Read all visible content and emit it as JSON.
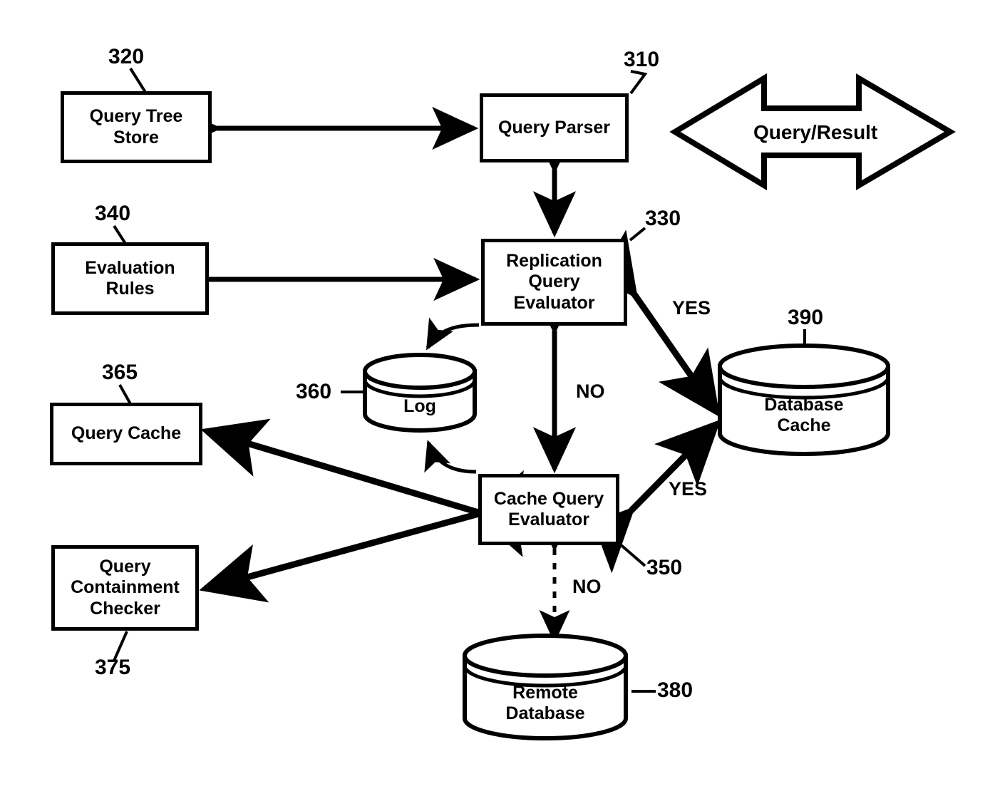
{
  "figure": {
    "type": "patent-block-diagram",
    "background": "#ffffff",
    "stroke_color": "#000000"
  },
  "nodes": {
    "query_tree_store": {
      "label": "Query Tree\nStore",
      "line1": "Query Tree",
      "line2": "Store",
      "ref": "320"
    },
    "query_parser": {
      "label": "Query Parser",
      "line1": "Query Parser",
      "ref": "310"
    },
    "evaluation_rules": {
      "line1": "Evaluation",
      "line2": "Rules",
      "ref": "340"
    },
    "replication_query_evaluator": {
      "line1": "Replication",
      "line2": "Query",
      "line3": "Evaluator",
      "ref": "330"
    },
    "query_cache": {
      "line1": "Query Cache",
      "ref": "365"
    },
    "query_containment_checker": {
      "line1": "Query",
      "line2": "Containment",
      "line3": "Checker",
      "ref": "375"
    },
    "cache_query_evaluator": {
      "line1": "Cache Query",
      "line2": "Evaluator",
      "ref": "350"
    },
    "log": {
      "line1": "Log",
      "ref": "360"
    },
    "database_cache": {
      "line1": "Database",
      "line2": "Cache",
      "ref": "390"
    },
    "remote_database": {
      "line1": "Remote",
      "line2": "Database",
      "ref": "380"
    }
  },
  "annotations": {
    "query_result": "Query/Result",
    "yes_upper": "YES",
    "yes_lower": "YES",
    "no_middle": "NO",
    "no_lower": "NO"
  },
  "chart_data": {
    "type": "diagram",
    "title": "",
    "nodes": [
      {
        "id": "320",
        "name": "Query Tree Store",
        "shape": "rect"
      },
      {
        "id": "310",
        "name": "Query Parser",
        "shape": "rect"
      },
      {
        "id": "340",
        "name": "Evaluation Rules",
        "shape": "rect"
      },
      {
        "id": "330",
        "name": "Replication Query Evaluator",
        "shape": "rect"
      },
      {
        "id": "365",
        "name": "Query Cache",
        "shape": "rect"
      },
      {
        "id": "375",
        "name": "Query Containment Checker",
        "shape": "rect"
      },
      {
        "id": "350",
        "name": "Cache Query Evaluator",
        "shape": "rect"
      },
      {
        "id": "360",
        "name": "Log",
        "shape": "cylinder"
      },
      {
        "id": "390",
        "name": "Database Cache",
        "shape": "cylinder"
      },
      {
        "id": "380",
        "name": "Remote Database",
        "shape": "cylinder"
      }
    ],
    "edges": [
      {
        "from": "310",
        "to": "320",
        "style": "double-arrow",
        "label": ""
      },
      {
        "from": "310",
        "to": "external",
        "style": "double-arrow-block",
        "label": "Query/Result"
      },
      {
        "from": "310",
        "to": "330",
        "style": "double-arrow",
        "label": ""
      },
      {
        "from": "330",
        "to": "340",
        "style": "double-arrow",
        "label": ""
      },
      {
        "from": "330",
        "to": "390",
        "style": "double-arrow",
        "label": "YES"
      },
      {
        "from": "330",
        "to": "350",
        "style": "double-arrow",
        "label": "NO"
      },
      {
        "from": "330",
        "to": "360",
        "style": "curved-arrow",
        "label": ""
      },
      {
        "from": "350",
        "to": "360",
        "style": "curved-arrow",
        "label": ""
      },
      {
        "from": "350",
        "to": "365",
        "style": "double-arrow",
        "label": ""
      },
      {
        "from": "350",
        "to": "375",
        "style": "double-arrow",
        "label": ""
      },
      {
        "from": "350",
        "to": "390",
        "style": "double-arrow",
        "label": "YES"
      },
      {
        "from": "350",
        "to": "380",
        "style": "dashed-double-arrow",
        "label": "NO"
      }
    ]
  }
}
